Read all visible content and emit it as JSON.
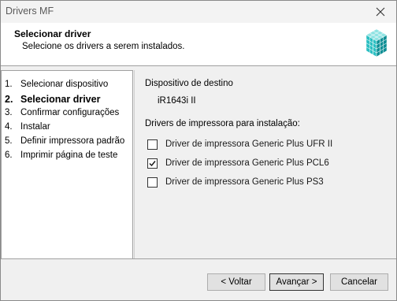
{
  "window": {
    "title": "Drivers MF"
  },
  "header": {
    "title": "Selecionar driver",
    "subtitle": "Selecione os drivers a serem instalados."
  },
  "steps": [
    {
      "num": "1.",
      "label": "Selecionar dispositivo",
      "active": false
    },
    {
      "num": "2.",
      "label": "Selecionar driver",
      "active": true
    },
    {
      "num": "3.",
      "label": "Confirmar configurações",
      "active": false
    },
    {
      "num": "4.",
      "label": "Instalar",
      "active": false
    },
    {
      "num": "5.",
      "label": "Definir impressora padrão",
      "active": false
    },
    {
      "num": "6.",
      "label": "Imprimir página de teste",
      "active": false
    }
  ],
  "content": {
    "destination_label": "Dispositivo de destino",
    "destination_value": "iR1643i II",
    "drivers_label": "Drivers de impressora para instalação:",
    "drivers": [
      {
        "label": "Driver de impressora Generic Plus UFR II",
        "checked": false
      },
      {
        "label": "Driver de impressora Generic Plus PCL6",
        "checked": true
      },
      {
        "label": "Driver de impressora Generic Plus PS3",
        "checked": false
      }
    ]
  },
  "buttons": {
    "back": "< Voltar",
    "next": "Avançar >",
    "cancel": "Cancelar"
  },
  "icons": {
    "close": "close-icon",
    "header": "cubes-icon",
    "check": "checkmark-icon"
  },
  "colors": {
    "cube_light": "#8fe3e3",
    "cube_mid": "#2bbfc2",
    "cube_dark": "#0f8f95"
  }
}
